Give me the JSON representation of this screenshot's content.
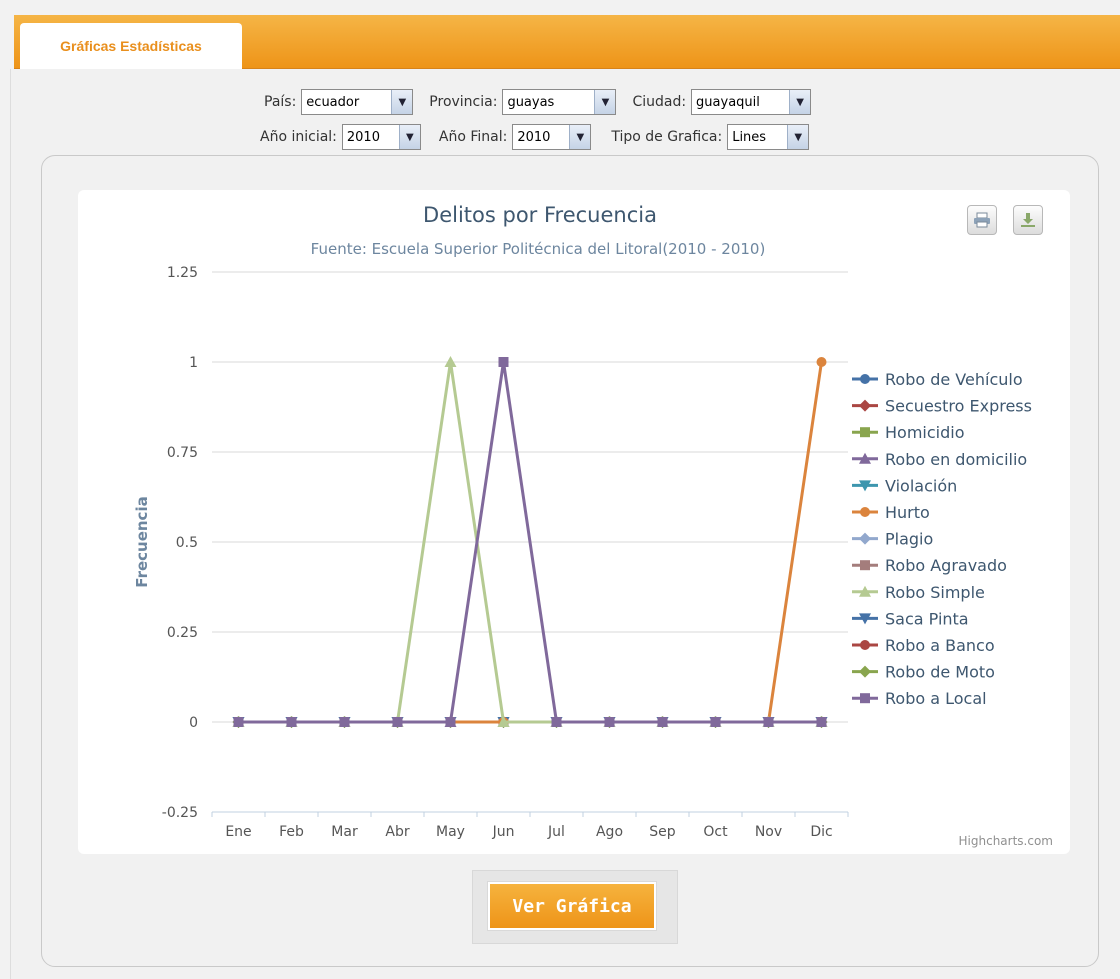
{
  "tab": {
    "label": "Gráficas Estadísticas"
  },
  "filters": {
    "pais": {
      "label": "País:",
      "value": "ecuador"
    },
    "provincia": {
      "label": "Provincia:",
      "value": "guayas"
    },
    "ciudad": {
      "label": "Ciudad:",
      "value": "guayaquil"
    },
    "anio_inicial": {
      "label": "Año inicial:",
      "value": "2010"
    },
    "anio_final": {
      "label": "Año Final:",
      "value": "2010"
    },
    "tipo": {
      "label": "Tipo de Grafica:",
      "value": "Lines"
    }
  },
  "icons": {
    "print": "print-icon",
    "export": "download-icon"
  },
  "credits": "Highcharts.com",
  "button": {
    "label": "Ver Gráfica"
  },
  "colors": {
    "accent": "#ee9418",
    "tab_text": "#e98f1d"
  },
  "chart_data": {
    "type": "line",
    "title": "Delitos por Frecuencia",
    "subtitle": "Fuente: Escuela Superior Politécnica del Litoral(2010 - 2010)",
    "xlabel": "",
    "ylabel": "Frecuencia",
    "ylim": [
      -0.25,
      1.25
    ],
    "yticks": [
      "-0.25",
      "0",
      "0.25",
      "0.5",
      "0.75",
      "1",
      "1.25"
    ],
    "yvals": [
      -0.25,
      0,
      0.25,
      0.5,
      0.75,
      1,
      1.25
    ],
    "categories": [
      "Ene",
      "Feb",
      "Mar",
      "Abr",
      "May",
      "Jun",
      "Jul",
      "Ago",
      "Sep",
      "Oct",
      "Nov",
      "Dic"
    ],
    "grid": true,
    "legend": "right",
    "series": [
      {
        "name": "Robo de Vehículo",
        "color": "#4572a7",
        "marker": "circle",
        "values": [
          0,
          0,
          0,
          0,
          0,
          0,
          0,
          0,
          0,
          0,
          0,
          0
        ]
      },
      {
        "name": "Secuestro Express",
        "color": "#aa4643",
        "marker": "diamond",
        "values": [
          0,
          0,
          0,
          0,
          0,
          0,
          0,
          0,
          0,
          0,
          0,
          0
        ]
      },
      {
        "name": "Homicidio",
        "color": "#89a54e",
        "marker": "square",
        "values": [
          0,
          0,
          0,
          0,
          0,
          0,
          0,
          0,
          0,
          0,
          0,
          0
        ]
      },
      {
        "name": "Robo en domicilio",
        "color": "#80699b",
        "marker": "triangle",
        "values": [
          0,
          0,
          0,
          0,
          0,
          0,
          0,
          0,
          0,
          0,
          0,
          0
        ]
      },
      {
        "name": "Violación",
        "color": "#3d96ae",
        "marker": "triangle-down",
        "values": [
          0,
          0,
          0,
          0,
          0,
          0,
          0,
          0,
          0,
          0,
          0,
          0
        ]
      },
      {
        "name": "Hurto",
        "color": "#db843d",
        "marker": "circle",
        "values": [
          0,
          0,
          0,
          0,
          0,
          0,
          0,
          0,
          0,
          0,
          0,
          1
        ]
      },
      {
        "name": "Plagio",
        "color": "#92a8cd",
        "marker": "diamond",
        "values": [
          0,
          0,
          0,
          0,
          0,
          0,
          0,
          0,
          0,
          0,
          0,
          0
        ]
      },
      {
        "name": "Robo Agravado",
        "color": "#a47d7c",
        "marker": "square",
        "values": [
          0,
          0,
          0,
          0,
          0,
          0,
          0,
          0,
          0,
          0,
          0,
          0
        ]
      },
      {
        "name": "Robo Simple",
        "color": "#b5ca92",
        "marker": "triangle",
        "values": [
          0,
          0,
          0,
          0,
          1,
          0,
          0,
          0,
          0,
          0,
          0,
          0
        ]
      },
      {
        "name": "Saca Pinta",
        "color": "#4572a7",
        "marker": "triangle-down",
        "values": [
          0,
          0,
          0,
          0,
          0,
          0,
          0,
          0,
          0,
          0,
          0,
          0
        ]
      },
      {
        "name": "Robo a Banco",
        "color": "#aa4643",
        "marker": "circle",
        "values": [
          0,
          0,
          0,
          0,
          0,
          0,
          0,
          0,
          0,
          0,
          0,
          0
        ]
      },
      {
        "name": "Robo de Moto",
        "color": "#89a54e",
        "marker": "diamond",
        "values": [
          0,
          0,
          0,
          0,
          0,
          0,
          0,
          0,
          0,
          0,
          0,
          0
        ]
      },
      {
        "name": "Robo a Local",
        "color": "#80699b",
        "marker": "square",
        "values": [
          0,
          0,
          0,
          0,
          0,
          1,
          0,
          0,
          0,
          0,
          0,
          0
        ]
      }
    ]
  }
}
